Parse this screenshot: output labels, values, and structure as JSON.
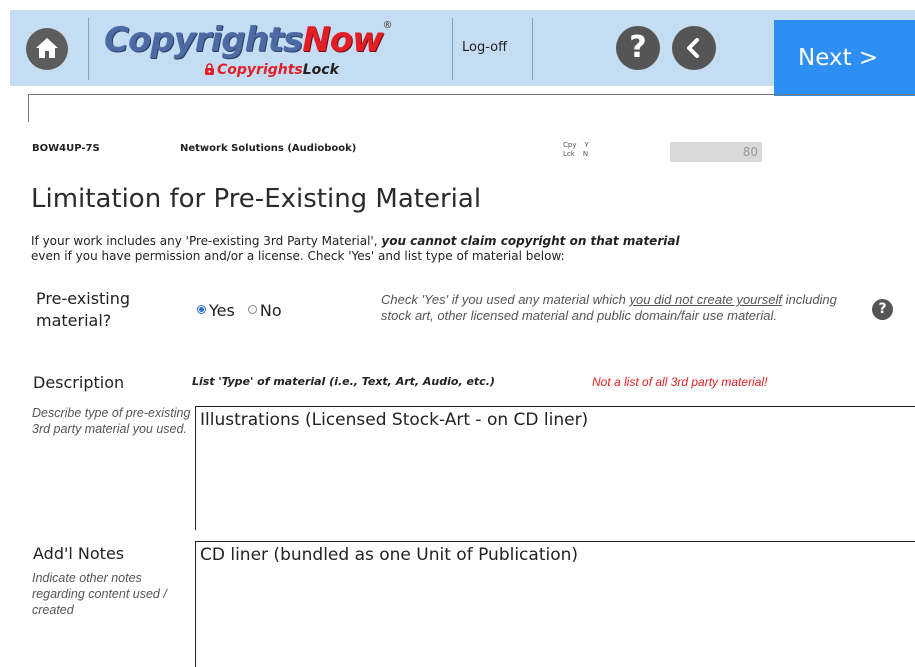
{
  "header": {
    "logo_main_a": "Copyrights",
    "logo_main_b": "Now",
    "logo_reg": "®",
    "logo_sub_a": "Copyrights",
    "logo_sub_b": "Lock",
    "logoff_label": "Log-off",
    "help_glyph": "?",
    "next_label": "Next >",
    "icons": [
      "home-icon",
      "help-icon",
      "back-icon"
    ],
    "colors": {
      "header_bg": "#c4ddf3",
      "next_bg": "#2d8ff2",
      "brand_blue": "#4d6aa5",
      "brand_red": "#e21f26"
    }
  },
  "record": {
    "id": "BOW4UP-7S",
    "title": "Network Solutions (Audiobook)",
    "cpy_label": "Cpy",
    "cpy_value": "Y",
    "lck_label": "Lck",
    "lck_value": "N",
    "number": "80"
  },
  "page": {
    "title": "Limitation for Pre-Existing Material",
    "intro_a": "If your work includes any 'Pre-existing 3rd Party Material', ",
    "intro_em": "you cannot claim copyright on that material",
    "intro_b": "even if you have permission and/or a license.  Check 'Yes' and list type of material below:"
  },
  "pre_existing": {
    "label": "Pre-existing material?",
    "options": [
      "Yes",
      "No"
    ],
    "selected": "Yes",
    "hint_a": "Check 'Yes' if you used any material which ",
    "hint_u": "you did not create yourself",
    "hint_b": " including stock art, other licensed material and public domain/fair use material.",
    "help_glyph": "?"
  },
  "description": {
    "label": "Description",
    "instruction": "List 'Type' of material (i.e., Text, Art, Audio, etc.)",
    "warning": "Not a list of all 3rd party material!",
    "side_help": "Describe type of pre-existing 3rd party material you used.",
    "value": "Illustrations (Licensed Stock-Art - on CD liner)"
  },
  "notes": {
    "label": "Add'l Notes",
    "side_help": "Indicate other notes regarding content used / created",
    "value": "CD liner (bundled as one Unit of Publication)"
  }
}
